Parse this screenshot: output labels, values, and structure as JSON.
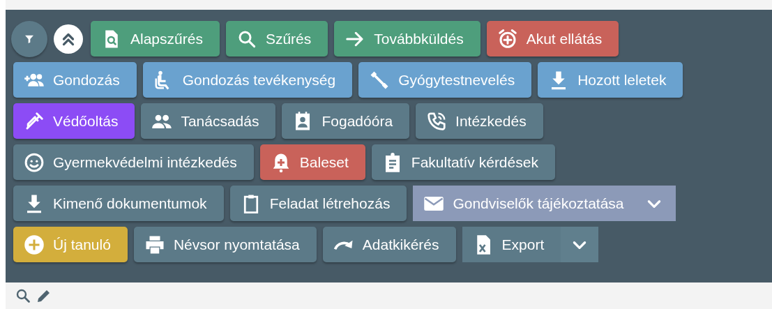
{
  "rows": [
    {
      "buttons": [
        {
          "label": "Alapszűrés",
          "color": "#4e9e7c",
          "kind": "button"
        },
        {
          "label": "Szűrés",
          "color": "#4e9e7c",
          "kind": "button"
        },
        {
          "label": "Továbbküldés",
          "color": "#4e9e7c",
          "kind": "button"
        },
        {
          "label": "Akut ellátás",
          "color": "#c9625a",
          "kind": "button"
        }
      ]
    },
    {
      "buttons": [
        {
          "label": "Gondozás",
          "color": "#6aa2cf",
          "kind": "button"
        },
        {
          "label": "Gondozás tevékenység",
          "color": "#6aa2cf",
          "kind": "button"
        },
        {
          "label": "Gyógytestnevelés",
          "color": "#6aa2cf",
          "kind": "button"
        },
        {
          "label": "Hozott leletek",
          "color": "#6aa2cf",
          "kind": "button"
        }
      ]
    },
    {
      "buttons": [
        {
          "label": "Védőoltás",
          "color": "#8c4cf5",
          "kind": "button"
        },
        {
          "label": "Tanácsadás",
          "color": "#5c7a88",
          "kind": "button"
        },
        {
          "label": "Fogadóóra",
          "color": "#5c7a88",
          "kind": "button"
        },
        {
          "label": "Intézkedés",
          "color": "#5c7a88",
          "kind": "button"
        }
      ]
    },
    {
      "buttons": [
        {
          "label": "Gyermekvédelmi intézkedés",
          "color": "#5c7a88",
          "kind": "button"
        },
        {
          "label": "Baleset",
          "color": "#c9625a",
          "kind": "button"
        },
        {
          "label": "Fakultatív kérdések",
          "color": "#5c7a88",
          "kind": "button"
        }
      ]
    },
    {
      "buttons": [
        {
          "label": "Kimenő dokumentumok",
          "color": "#5c7a88",
          "kind": "button"
        },
        {
          "label": "Feladat létrehozás",
          "color": "#5c7a88",
          "kind": "button"
        },
        {
          "label": "Gondviselők tájékoztatása",
          "color": "#8c9ab8",
          "kind": "dropdown"
        }
      ]
    },
    {
      "buttons": [
        {
          "label": "Új tanuló",
          "color": "#d3ae3c",
          "kind": "button"
        },
        {
          "label": "Névsor nyomtatása",
          "color": "#5c7a88",
          "kind": "button"
        },
        {
          "label": "Adatkikérés",
          "color": "#5c7a88",
          "kind": "button"
        },
        {
          "label": "Export",
          "color": "#5c7a88",
          "kind": "split"
        }
      ]
    }
  ]
}
